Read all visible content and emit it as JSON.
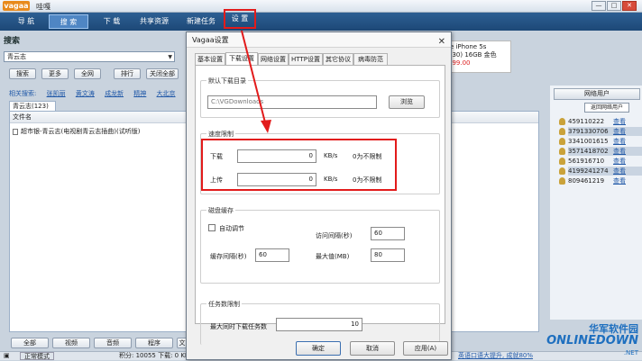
{
  "app": {
    "logo": "vagaa",
    "title": "哇嘎",
    "win_min": "—",
    "win_max": "□",
    "win_close": "✕"
  },
  "nav": {
    "tabs": [
      "导 航",
      "搜 索",
      "下 载",
      "共享资源",
      "新建任务",
      "设 置"
    ],
    "active_index": 1
  },
  "search": {
    "heading": "搜索",
    "query": "青云志",
    "buttons": [
      "搜索",
      "更多",
      "全网",
      "排行",
      "关闭全部"
    ],
    "related_label": "相关搜索:",
    "related_links": [
      "张凯丽",
      "黄文涛",
      "成龙新",
      "精神",
      "大北京"
    ],
    "result_tab": "青云志(123)",
    "column_header": "文件名",
    "results": [
      "超市银-青云志(电视剧青云志插曲)(试听版)"
    ]
  },
  "bottom_buttons": [
    "全部",
    "视频",
    "音频",
    "程序",
    "文"
  ],
  "status": {
    "mode": "正常模式",
    "stats": "积分: 10055  下载: 0 KB/s",
    "ad_link": "英语口语大提升, 成就80%"
  },
  "ad": {
    "line1": "le iPhone 5s",
    "line2": "530) 16GB 金色",
    "price": "999.00"
  },
  "online_users": {
    "header": "网络用户",
    "refresh_button": "返回网络用户",
    "users": [
      {
        "id": "459110222",
        "link": "查看"
      },
      {
        "id": "3791330706",
        "link": "查看"
      },
      {
        "id": "3341001615",
        "link": "查看"
      },
      {
        "id": "3571418702",
        "link": "查看"
      },
      {
        "id": "561916710",
        "link": "查看"
      },
      {
        "id": "4199241274",
        "link": "查看"
      },
      {
        "id": "809461219",
        "link": "查看"
      }
    ]
  },
  "dialog": {
    "title": "Vagaa设置",
    "close": "✕",
    "tabs": [
      "基本设置",
      "下载设置",
      "网络设置",
      "HTTP设置",
      "其它协议",
      "病毒防范"
    ],
    "active_tab": 1,
    "default_dir": {
      "label": "默认下载目录",
      "path": "C:\\VGDownloads",
      "browse": "浏览"
    },
    "speed_limit": {
      "label": "速度限制",
      "download_label": "下载",
      "download_value": "0",
      "upload_label": "上传",
      "upload_value": "0",
      "unit": "KB/s",
      "note": "0为不限制"
    },
    "disk_cache": {
      "label": "磁盘缓存",
      "auto_adjust": "自动调节",
      "access_interval_label": "访问间隔(秒)",
      "access_interval_value": "60",
      "flush_interval_label": "缓存间隔(秒)",
      "flush_interval_value": "60",
      "max_label": "最大值(MB)",
      "max_value": "80"
    },
    "task_limit": {
      "label": "任务数限制",
      "max_tasks_label": "最大同时下载任务数",
      "max_tasks_value": "10"
    },
    "buttons": {
      "ok": "确定",
      "cancel": "取消",
      "apply": "应用(A)"
    }
  },
  "watermark": {
    "line1": "华军软件园",
    "line2": "ONLINEDOWN",
    "line3": ".NET"
  },
  "colors": {
    "nav_bg": "#1d4877",
    "annotation_red": "#e21b1b",
    "link_blue": "#2159a8"
  }
}
